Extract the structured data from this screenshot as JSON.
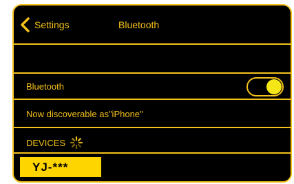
{
  "nav": {
    "back_label": "Settings",
    "title": "Bluetooth"
  },
  "bluetooth_row": {
    "label": "Bluetooth",
    "toggle_on": true
  },
  "discoverable_text": "Now discoverable as\"iPhone\"",
  "devices_header": "DEVICES",
  "devices": [
    {
      "name": "YJ-***"
    }
  ],
  "colors": {
    "accent": "#f5c21b",
    "background": "#000000",
    "highlight": "#ffd500",
    "knob": "#f5e617"
  },
  "icons": {
    "back": "chevron-left-icon",
    "spinner": "spinner-icon"
  }
}
